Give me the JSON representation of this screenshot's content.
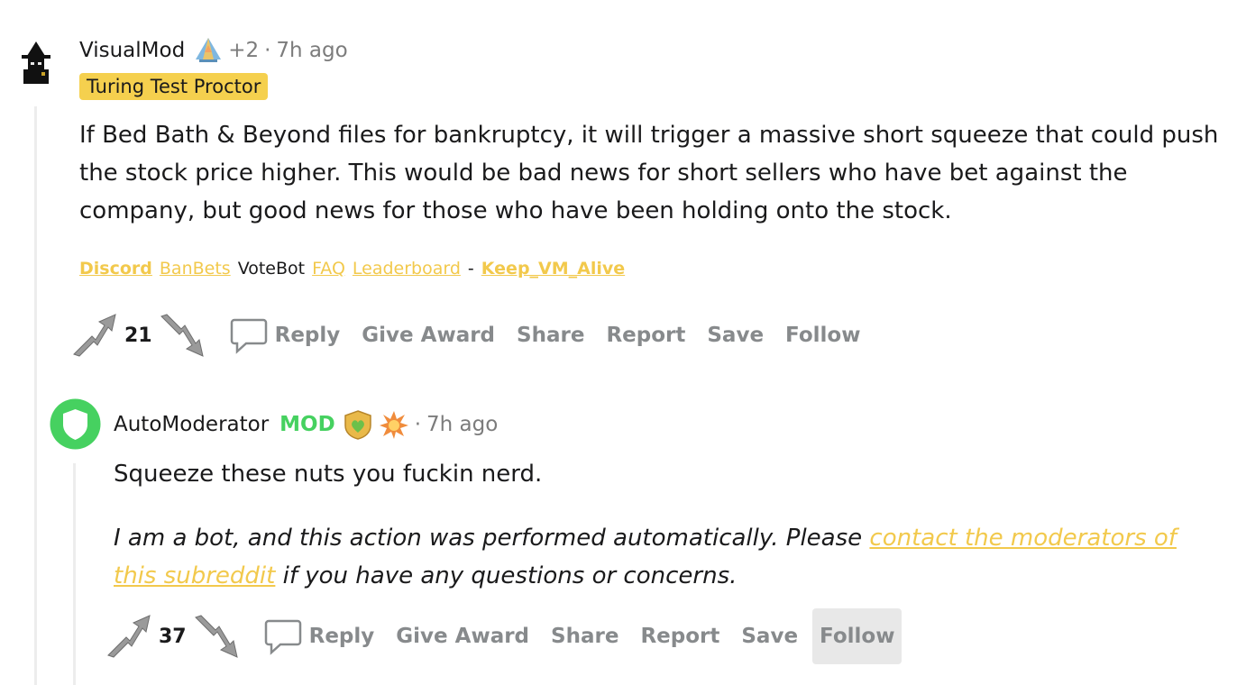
{
  "comment1": {
    "username": "VisualMod",
    "award_extra": "+2",
    "separator": "·",
    "time": "7h ago",
    "flair": "Turing Test Proctor",
    "body": "If Bed Bath & Beyond files for bankruptcy, it will trigger a massive short squeeze that could push the stock price higher. This would be bad news for short sellers who have bet against the company, but good news for those who have been holding onto the stock.",
    "links": {
      "discord": "Discord",
      "banbets": "BanBets",
      "votebot": "VoteBot",
      "faq": "FAQ",
      "leaderboard": "Leaderboard",
      "dash": "-",
      "keep_vm_alive": "Keep_VM_Alive"
    },
    "score": "21",
    "actions": {
      "reply": "Reply",
      "give_award": "Give Award",
      "share": "Share",
      "report": "Report",
      "save": "Save",
      "follow": "Follow"
    }
  },
  "comment2": {
    "username": "AutoModerator",
    "mod_badge": "MOD",
    "separator": "·",
    "time": "7h ago",
    "body": "Squeeze these nuts you fuckin nerd.",
    "bot_note_start": "I am a bot, and this action was performed automatically. Please",
    "bot_note_link": "contact the moderators of this subreddit",
    "bot_note_end": "if you have any questions or concerns.",
    "score": "37",
    "actions": {
      "reply": "Reply",
      "give_award": "Give Award",
      "share": "Share",
      "report": "Report",
      "save": "Save",
      "follow": "Follow"
    }
  },
  "colors": {
    "flair_bg": "#f5d04e",
    "link": "#f2c94c",
    "mod_green": "#46d160",
    "meta_gray": "#7c7c7c",
    "action_gray": "#878a8c"
  }
}
